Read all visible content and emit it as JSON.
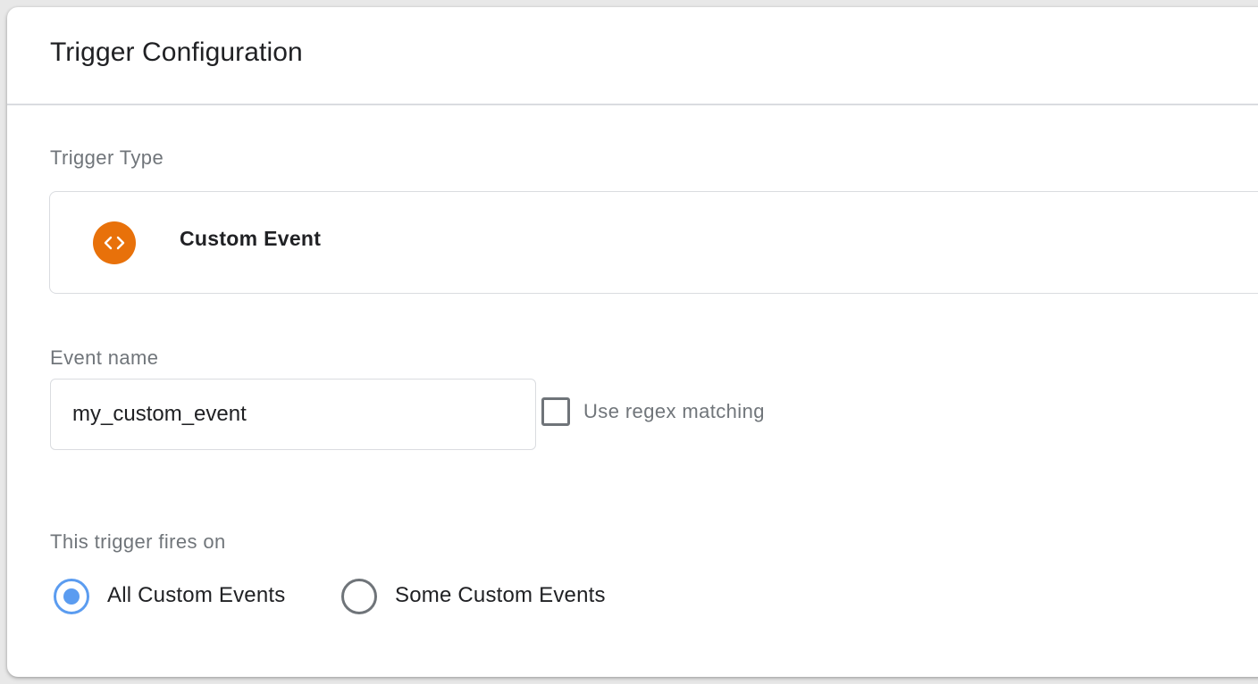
{
  "header": {
    "title": "Trigger Configuration"
  },
  "trigger_type": {
    "label": "Trigger Type",
    "selected_name": "Custom Event",
    "icon": "code-brackets-icon",
    "icon_color": "#e8710a"
  },
  "event_name": {
    "label": "Event name",
    "value": "my_custom_event"
  },
  "regex": {
    "label": "Use regex matching",
    "checked": false
  },
  "fires_on": {
    "label": "This trigger fires on",
    "options": [
      {
        "label": "All Custom Events",
        "selected": true
      },
      {
        "label": "Some Custom Events",
        "selected": false
      }
    ],
    "selected_color": "#5b9cf0"
  }
}
